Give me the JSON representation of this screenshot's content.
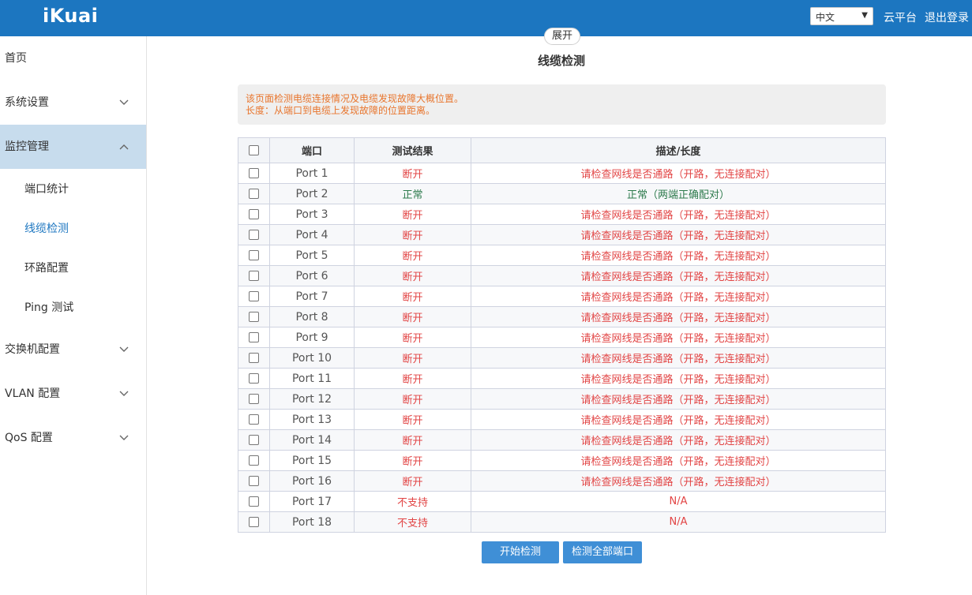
{
  "header": {
    "logo": "iKuai",
    "language": "中文",
    "cloud_label": "云平台",
    "logout_label": "退出登录",
    "expand_label": "展开"
  },
  "sidebar": {
    "items": [
      {
        "label": "首页",
        "has_chevron": false
      },
      {
        "label": "系统设置",
        "has_chevron": true
      },
      {
        "label": "监控管理",
        "has_chevron": true,
        "expanded": true
      },
      {
        "label": "交换机配置",
        "has_chevron": true
      },
      {
        "label": "VLAN 配置",
        "has_chevron": true
      },
      {
        "label": "QoS 配置",
        "has_chevron": true
      }
    ],
    "subitems": [
      {
        "label": "端口统计"
      },
      {
        "label": "线缆检测",
        "current": true
      },
      {
        "label": "环路配置"
      },
      {
        "label": "Ping 测试"
      }
    ]
  },
  "main": {
    "title": "线缆检测",
    "notice_line1": "该页面检测电缆连接情况及电缆发现故障大概位置。",
    "notice_line2": "长度：从端口到电缆上发现故障的位置距离。",
    "table": {
      "columns": [
        "端口",
        "测试结果",
        "描述/长度"
      ],
      "rows": [
        {
          "port": "Port 1",
          "result": "断开",
          "desc": "请检查网线是否通路（开路，无连接配对）",
          "status": "bad"
        },
        {
          "port": "Port 2",
          "result": "正常",
          "desc": "正常（两端正确配对）",
          "status": "ok"
        },
        {
          "port": "Port 3",
          "result": "断开",
          "desc": "请检查网线是否通路（开路，无连接配对）",
          "status": "bad"
        },
        {
          "port": "Port 4",
          "result": "断开",
          "desc": "请检查网线是否通路（开路，无连接配对）",
          "status": "bad"
        },
        {
          "port": "Port 5",
          "result": "断开",
          "desc": "请检查网线是否通路（开路，无连接配对）",
          "status": "bad"
        },
        {
          "port": "Port 6",
          "result": "断开",
          "desc": "请检查网线是否通路（开路，无连接配对）",
          "status": "bad"
        },
        {
          "port": "Port 7",
          "result": "断开",
          "desc": "请检查网线是否通路（开路，无连接配对）",
          "status": "bad"
        },
        {
          "port": "Port 8",
          "result": "断开",
          "desc": "请检查网线是否通路（开路，无连接配对）",
          "status": "bad"
        },
        {
          "port": "Port 9",
          "result": "断开",
          "desc": "请检查网线是否通路（开路，无连接配对）",
          "status": "bad"
        },
        {
          "port": "Port 10",
          "result": "断开",
          "desc": "请检查网线是否通路（开路，无连接配对）",
          "status": "bad"
        },
        {
          "port": "Port 11",
          "result": "断开",
          "desc": "请检查网线是否通路（开路，无连接配对）",
          "status": "bad"
        },
        {
          "port": "Port 12",
          "result": "断开",
          "desc": "请检查网线是否通路（开路，无连接配对）",
          "status": "bad"
        },
        {
          "port": "Port 13",
          "result": "断开",
          "desc": "请检查网线是否通路（开路，无连接配对）",
          "status": "bad"
        },
        {
          "port": "Port 14",
          "result": "断开",
          "desc": "请检查网线是否通路（开路，无连接配对）",
          "status": "bad"
        },
        {
          "port": "Port 15",
          "result": "断开",
          "desc": "请检查网线是否通路（开路，无连接配对）",
          "status": "bad"
        },
        {
          "port": "Port 16",
          "result": "断开",
          "desc": "请检查网线是否通路（开路，无连接配对）",
          "status": "bad"
        },
        {
          "port": "Port 17",
          "result": "不支持",
          "desc": "N/A",
          "status": "bad"
        },
        {
          "port": "Port 18",
          "result": "不支持",
          "desc": "N/A",
          "status": "bad"
        }
      ]
    },
    "buttons": {
      "start": "开始检测",
      "all": "检测全部端口"
    }
  },
  "colors": {
    "header_bg": "#1c76c0",
    "error_red": "#e24545",
    "ok_green": "#2d7a4c",
    "notice_orange": "#e8752d",
    "button_blue": "#3f8fd6"
  }
}
